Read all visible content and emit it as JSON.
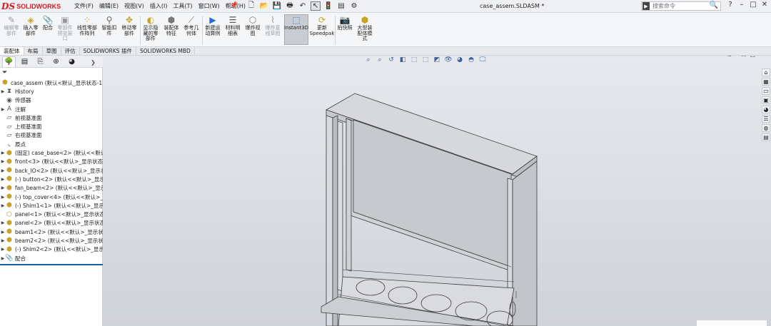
{
  "app": {
    "logo_mark": "DS",
    "logo_text": "SOLIDWORKS",
    "document_title": "case_assem.SLDASM *"
  },
  "menu": [
    "文件(F)",
    "编辑(E)",
    "视图(V)",
    "插入(I)",
    "工具(T)",
    "窗口(W)",
    "帮助(H)"
  ],
  "search": {
    "placeholder": "搜索命令"
  },
  "ribbon": [
    {
      "label": "编辑零\n部件",
      "icon": "edit-component-icon",
      "enabled": false
    },
    {
      "label": "插入零\n部件",
      "icon": "insert-component-icon",
      "enabled": true
    },
    {
      "label": "配合",
      "icon": "mate-icon",
      "enabled": true
    },
    {
      "label": "零部件\n预览窗\n口",
      "icon": "component-preview-icon",
      "enabled": false
    },
    {
      "label": "线性零部\n件阵列",
      "icon": "linear-pattern-icon",
      "enabled": true
    },
    {
      "label": "智能扣\n件",
      "icon": "smart-fastener-icon",
      "enabled": true
    },
    {
      "label": "移动零\n部件",
      "icon": "move-component-icon",
      "enabled": true
    },
    {
      "label": "显示隐\n藏的零\n部件",
      "icon": "show-hidden-icon",
      "enabled": true
    },
    {
      "label": "装配体\n特征",
      "icon": "assembly-feature-icon",
      "enabled": true
    },
    {
      "label": "参考几\n何体",
      "icon": "reference-geometry-icon",
      "enabled": true
    },
    {
      "label": "新建运\n动算例",
      "icon": "motion-study-icon",
      "enabled": true
    },
    {
      "label": "材料明\n细表",
      "icon": "bom-icon",
      "enabled": true
    },
    {
      "label": "爆炸视\n图",
      "icon": "exploded-view-icon",
      "enabled": true
    },
    {
      "label": "爆炸直\n线草图",
      "icon": "explode-line-sketch-icon",
      "enabled": false
    },
    {
      "label": "Instant3D",
      "icon": "instant3d-icon",
      "enabled": true,
      "active": true
    },
    {
      "label": "更新\nSpeedpak",
      "icon": "speedpak-icon",
      "enabled": true
    },
    {
      "label": "拍快照",
      "icon": "snapshot-icon",
      "enabled": true
    },
    {
      "label": "大型装\n配体模\n式",
      "icon": "large-assembly-icon",
      "enabled": true
    }
  ],
  "tabs": [
    "装配体",
    "布局",
    "草图",
    "评估",
    "SOLIDWORKS 插件",
    "SOLIDWORKS MBD"
  ],
  "tree": {
    "root": "case_assem  (默认<默认_显示状态-1>)",
    "items": [
      {
        "label": "History",
        "icon": "history-icon",
        "expand": true
      },
      {
        "label": "传感器",
        "icon": "sensor-icon",
        "expand": false
      },
      {
        "label": "注解",
        "icon": "annotation-icon",
        "expand": true
      },
      {
        "label": "前视基准面",
        "icon": "plane-icon",
        "expand": false
      },
      {
        "label": "上视基准面",
        "icon": "plane-icon",
        "expand": false
      },
      {
        "label": "右视基准面",
        "icon": "plane-icon",
        "expand": false
      },
      {
        "label": "原点",
        "icon": "origin-icon",
        "expand": false
      },
      {
        "label": "(固定) case_base<2> (默认<<默认>_",
        "icon": "part-icon",
        "expand": true
      },
      {
        "label": "front<3> (默认<<默认>_显示状态 1>",
        "icon": "part-icon",
        "expand": true
      },
      {
        "label": "back_IO<2> (默认<<默认>_显示状态",
        "icon": "part-icon",
        "expand": true
      },
      {
        "label": "(-) button<2> (默认<<默认>_显示状态",
        "icon": "part-icon",
        "expand": true
      },
      {
        "label": "fan_beam<2> (默认<<默认>_显示状",
        "icon": "part-icon",
        "expand": true
      },
      {
        "label": "(-) top_cover<4> (默认<<默认>_显示",
        "icon": "part-icon",
        "expand": true
      },
      {
        "label": "(-) Shim1<1> (默认<<默认>_显示状态",
        "icon": "part-icon",
        "expand": true
      },
      {
        "label": "panel<1> (默认<<默认>_显示状态 1>",
        "icon": "part-outline-icon",
        "expand": false
      },
      {
        "label": "panel<2> (默认<<默认>_显示状态 1>",
        "icon": "part-icon",
        "expand": true
      },
      {
        "label": "beam1<2> (默认<<默认>_显示状态",
        "icon": "part-icon",
        "expand": true
      },
      {
        "label": "beam2<2> (默认<<默认>_显示状态",
        "icon": "part-icon",
        "expand": true
      },
      {
        "label": "(-) Shim2<2> (默认<<默认>_显示状",
        "icon": "part-icon",
        "expand": true
      },
      {
        "label": "配合",
        "icon": "mates-folder-icon",
        "expand": true
      }
    ]
  },
  "colors": {
    "brand": "#d71920",
    "accent": "#1e5aa8",
    "viewport_top": "#e6e9ee",
    "viewport_bottom": "#cfd3da",
    "model_edge": "#3c3c3c",
    "model_face": "#d6d8dc"
  }
}
